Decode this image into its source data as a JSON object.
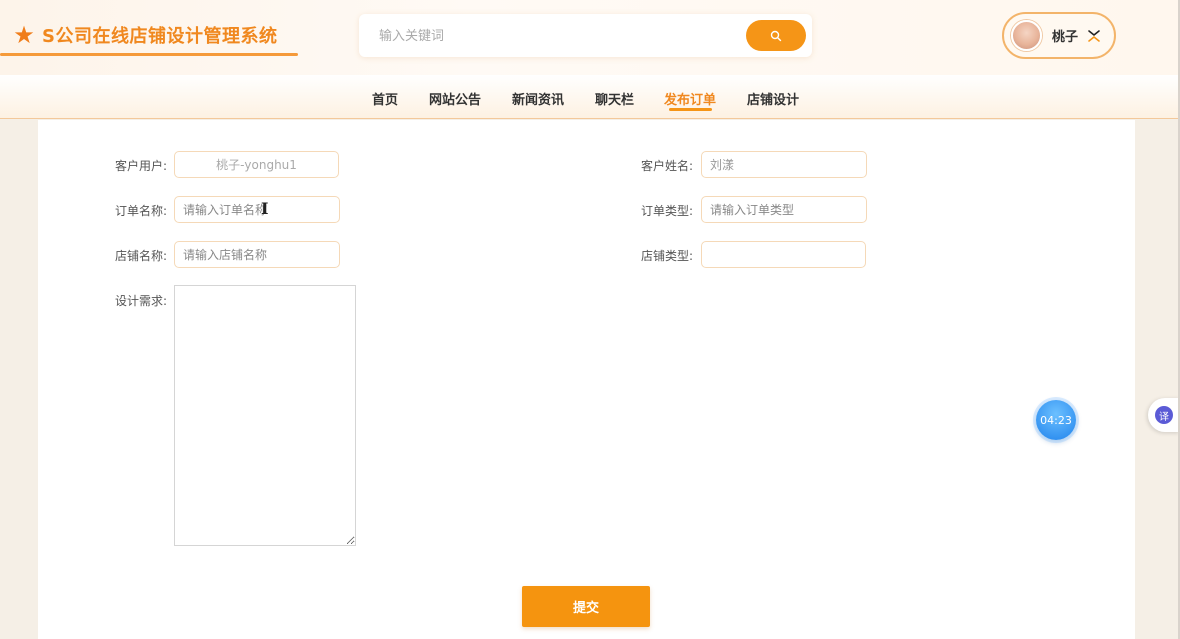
{
  "header": {
    "logo_icon": "star-icon",
    "app_title": "S公司在线店铺设计管理系统",
    "search": {
      "placeholder": "输入关键词",
      "button_icon": "search-icon"
    },
    "user": {
      "name": "桃子",
      "menu_icon": "collapse-icon"
    }
  },
  "nav": {
    "items": [
      {
        "label": "首页",
        "active": false
      },
      {
        "label": "网站公告",
        "active": false
      },
      {
        "label": "新闻资讯",
        "active": false
      },
      {
        "label": "聊天栏",
        "active": false
      },
      {
        "label": "发布订单",
        "active": true
      },
      {
        "label": "店铺设计",
        "active": false
      }
    ]
  },
  "form": {
    "customer_user": {
      "label": "客户用户:",
      "value": "桃子-yonghu1"
    },
    "customer_name": {
      "label": "客户姓名:",
      "value": "刘漾"
    },
    "order_name": {
      "label": "订单名称:",
      "placeholder": "请输入订单名称"
    },
    "order_type": {
      "label": "订单类型:",
      "placeholder": "请输入订单类型"
    },
    "shop_name": {
      "label": "店铺名称:",
      "placeholder": "请输入店铺名称"
    },
    "shop_type": {
      "label": "店铺类型:",
      "value": ""
    },
    "design_requirements": {
      "label": "设计需求:",
      "value": ""
    },
    "submit_label": "提交"
  },
  "overlay": {
    "timer": "04:23",
    "translate_glyph": "译"
  },
  "colors": {
    "accent": "#f59517",
    "brand_text": "#f0881f",
    "timer_blue": "#2f8ff0"
  }
}
